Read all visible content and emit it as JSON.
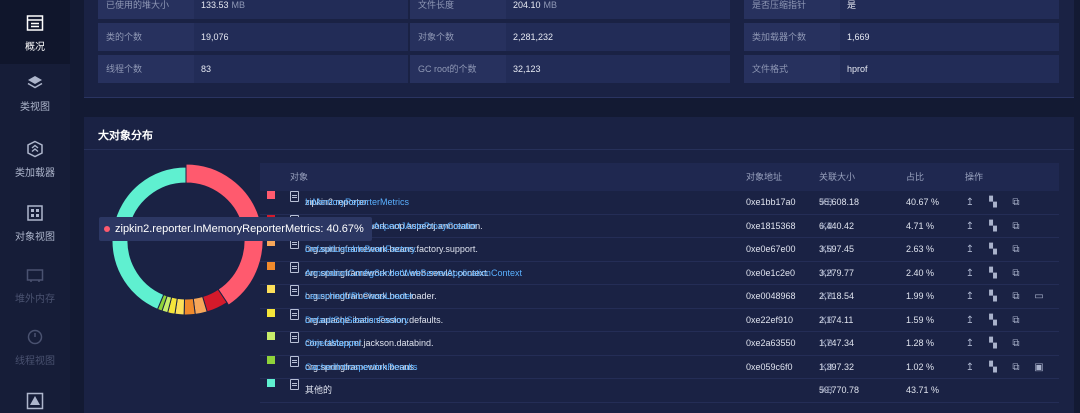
{
  "sidebar": {
    "items": [
      {
        "label": "概况",
        "icon": "dashboard-icon",
        "active": true
      },
      {
        "label": "类视图",
        "icon": "layers-icon"
      },
      {
        "label": "类加载器",
        "icon": "loader-icon"
      },
      {
        "label": "对象视图",
        "icon": "grid-icon"
      },
      {
        "label": "堆外内存",
        "icon": "memory-icon",
        "disabled": true
      },
      {
        "label": "线程视图",
        "icon": "thread-icon",
        "disabled": true
      },
      {
        "label": "",
        "icon": "warning-icon",
        "disabled": true
      }
    ]
  },
  "summary": {
    "rows": [
      [
        {
          "key": "已使用的堆大小",
          "value": "133.53",
          "unit": "MB"
        },
        {
          "key": "文件长度",
          "value": "204.10",
          "unit": "MB"
        },
        {
          "key": "是否压缩指针",
          "value": "是",
          "unit": ""
        }
      ],
      [
        {
          "key": "类的个数",
          "value": "19,076",
          "unit": ""
        },
        {
          "key": "对象个数",
          "value": "2,281,232",
          "unit": ""
        },
        {
          "key": "类加载器个数",
          "value": "1,669",
          "unit": ""
        }
      ],
      [
        {
          "key": "线程个数",
          "value": "83",
          "unit": ""
        },
        {
          "key": "GC root的个数",
          "value": "32,123",
          "unit": ""
        },
        {
          "key": "文件格式",
          "value": "hprof",
          "unit": ""
        }
      ]
    ]
  },
  "section": {
    "title": "大对象分布"
  },
  "tooltip": {
    "text": "zipkin2.reporter.InMemoryReporterMetrics: 40.67%"
  },
  "table": {
    "headers": {
      "object": "对象",
      "address": "对象地址",
      "size": "关联大小",
      "percent": "占比",
      "actions": "操作"
    },
    "rows": [
      {
        "color": "#ff5a6e",
        "pkg": "zipkin2.reporter.",
        "cls": "InMemoryReporterMetrics",
        "address": "0xe1bb17a0",
        "size": "55,608.18",
        "unit": "KB",
        "pct": "40.67 %",
        "pct_value": 40.67
      },
      {
        "color": "#d41a2b",
        "pkg": "org.springframework.aop.aspectj.annotation.",
        "cls": "AnnotationAwareAspectJAutoProxyCreator",
        "address": "0xe1815368",
        "size": "6,440.42",
        "unit": "KB",
        "pct": "4.71 %",
        "pct_value": 4.71
      },
      {
        "color": "#f7a75a",
        "pkg": "org.springframework.beans.factory.support.",
        "cls": "DefaultListableBeanFactory",
        "address": "0xe0e67e00",
        "size": "3,597.45",
        "unit": "KB",
        "pct": "2.63 %",
        "pct_value": 2.63
      },
      {
        "color": "#f08a2c",
        "pkg": "org.springframework.boot.web.servlet.context.",
        "cls": "AnnotationConfigServletWebServerApplicationContext",
        "address": "0xe0e1c2e0",
        "size": "3,279.77",
        "unit": "KB",
        "pct": "2.40 %",
        "pct_value": 2.4
      },
      {
        "color": "#fde05a",
        "pkg": "org.springframework.boot.loader.",
        "cls": "LaunchedURLClassLoader",
        "address": "0xe0048968",
        "size": "2,718.54",
        "unit": "KB",
        "pct": "1.99 %",
        "pct_value": 1.99
      },
      {
        "color": "#f5e53a",
        "pkg": "org.apache.ibatis.session.defaults.",
        "cls": "DefaultSqlSessionFactory",
        "address": "0xe22ef910",
        "size": "2,174.11",
        "unit": "KB",
        "pct": "1.59 %",
        "pct_value": 1.59
      },
      {
        "color": "#c8ee6a",
        "pkg": "com.fasterxml.jackson.databind.",
        "cls": "ObjectMapper",
        "address": "0xe2a63550",
        "size": "1,747.34",
        "unit": "KB",
        "pct": "1.28 %",
        "pct_value": 1.28
      },
      {
        "color": "#8fd33a",
        "pkg": "org.springframework.beans.",
        "cls": "CachedIntrospectionResults",
        "address": "0xe059c6f0",
        "size": "1,397.32",
        "unit": "KB",
        "pct": "1.02 %",
        "pct_value": 1.02
      },
      {
        "color": "#5ff0d0",
        "pkg": "其他的",
        "cls": "",
        "address": "",
        "size": "59,770.78",
        "unit": "KB",
        "pct": "43.71 %",
        "pct_value": 43.71
      }
    ]
  }
}
